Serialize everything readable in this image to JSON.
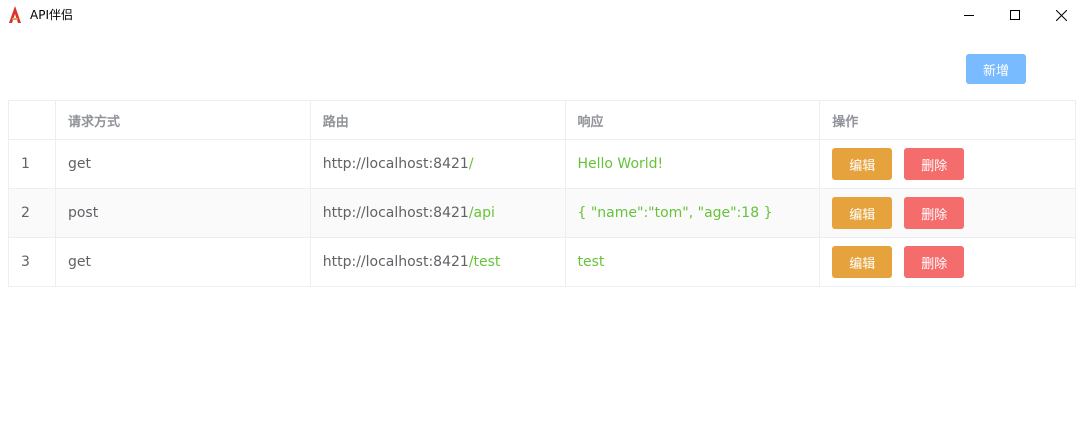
{
  "window": {
    "title": "API伴侣",
    "icon": "app-logo-icon"
  },
  "toolbar": {
    "add_label": "新增"
  },
  "table": {
    "headers": [
      "",
      "请求方式",
      "路由",
      "响应",
      "操作"
    ],
    "rows": [
      {
        "index": "1",
        "method": "get",
        "path_base": "http://localhost:8421",
        "path_route": "/",
        "response": "Hello World!",
        "edit": "编辑",
        "delete": "删除"
      },
      {
        "index": "2",
        "method": "post",
        "path_base": "http://localhost:8421",
        "path_route": "/api",
        "response": "{ \"name\":\"tom\", \"age\":18 }",
        "edit": "编辑",
        "delete": "删除"
      },
      {
        "index": "3",
        "method": "get",
        "path_base": "http://localhost:8421",
        "path_route": "/test",
        "response": "test",
        "edit": "编辑",
        "delete": "删除"
      }
    ]
  },
  "colors": {
    "primary_light": "#79bbff",
    "warning": "#e6a23c",
    "danger": "#f56c6c",
    "success": "#67c23a"
  }
}
